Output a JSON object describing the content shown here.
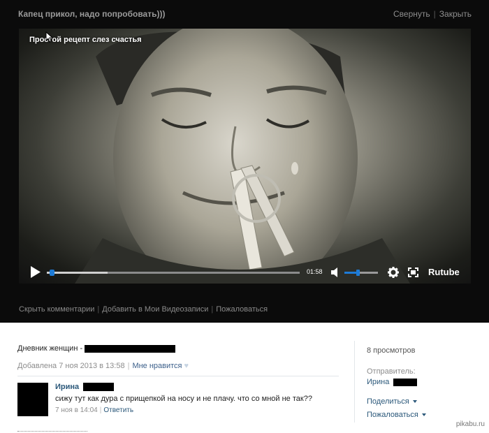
{
  "window": {
    "title": "Капец прикол, надо попробовать)))",
    "collapse_label": "Свернуть",
    "close_label": "Закрыть"
  },
  "player": {
    "video_title": "Простой рецепт слез счастья",
    "time": "01:58",
    "progress_fraction": 0.02,
    "buffered_fraction": 0.24,
    "volume_fraction": 0.4,
    "brand": "Rutube",
    "accent_color": "#1e7bd6"
  },
  "video_links": {
    "hide_comments": "Скрыть комментарии",
    "add_to_videos": "Добавить в Мои Видеозаписи",
    "report": "Пожаловаться"
  },
  "info": {
    "source_prefix": "Дневник женщин -",
    "added_date": "Добавлена 7 ноя 2013 в 13:58",
    "like_label": "Мне нравится"
  },
  "comment": {
    "author": "Ирина",
    "text": "сижу тут как дура с прищепкой на носу и не плачу. что со мной не так??",
    "date": "7 ноя в 14:04",
    "reply_label": "Ответить"
  },
  "sidebar": {
    "views": "8 просмотров",
    "sender_label": "Отправитель:",
    "sender_name": "Ирина",
    "share_label": "Поделиться",
    "report_label": "Пожаловаться"
  },
  "watermark": "pikabu.ru",
  "icons": [
    "cursor-icon",
    "play-icon",
    "volume-icon",
    "gear-icon",
    "fullscreen-icon",
    "heart-icon",
    "dropdown-caret-icon"
  ]
}
